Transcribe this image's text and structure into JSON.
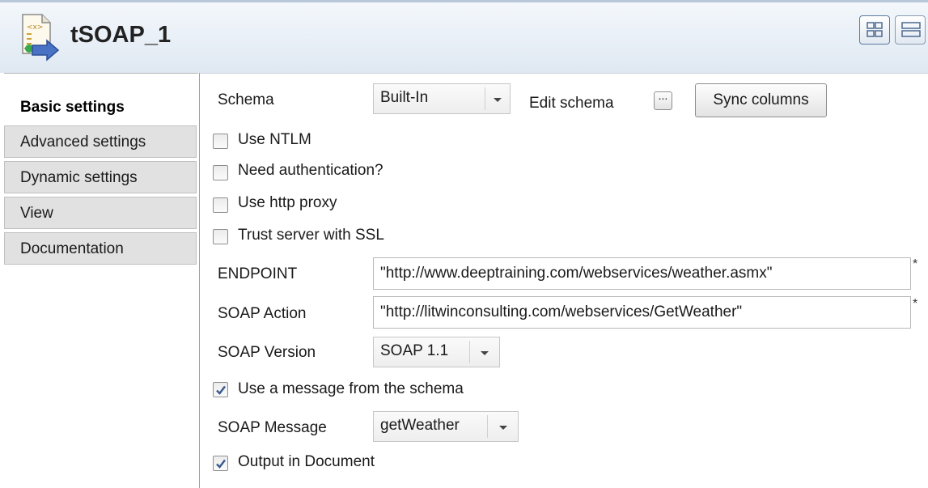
{
  "header": {
    "title": "tSOAP_1"
  },
  "tabs": [
    {
      "label": "Basic settings",
      "active": true
    },
    {
      "label": "Advanced settings",
      "active": false
    },
    {
      "label": "Dynamic settings",
      "active": false
    },
    {
      "label": "View",
      "active": false
    },
    {
      "label": "Documentation",
      "active": false
    }
  ],
  "schema": {
    "label": "Schema",
    "value": "Built-In",
    "edit_label": "Edit schema",
    "edit_button": "...",
    "sync_button": "Sync columns"
  },
  "checkboxes": {
    "use_ntlm": {
      "label": "Use NTLM",
      "checked": false
    },
    "need_auth": {
      "label": "Need authentication?",
      "checked": false
    },
    "use_proxy": {
      "label": "Use http proxy",
      "checked": false
    },
    "trust_ssl": {
      "label": "Trust server with SSL",
      "checked": false
    },
    "use_message": {
      "label": "Use a message from the schema",
      "checked": true
    },
    "output_doc": {
      "label": "Output in Document",
      "checked": true
    }
  },
  "endpoint": {
    "label": "ENDPOINT",
    "value": "\"http://www.deeptraining.com/webservices/weather.asmx\"",
    "required": "*"
  },
  "soap_action": {
    "label": "SOAP Action",
    "value": "\"http://litwinconsulting.com/webservices/GetWeather\"",
    "required": "*"
  },
  "soap_version": {
    "label": "SOAP Version",
    "value": "SOAP 1.1"
  },
  "soap_message": {
    "label": "SOAP Message",
    "value": "getWeather"
  },
  "colors": {
    "tab_inactive": "#e1e1e1",
    "header_bg": "#dfe8f2",
    "check_mark": "#3a5a8c"
  }
}
